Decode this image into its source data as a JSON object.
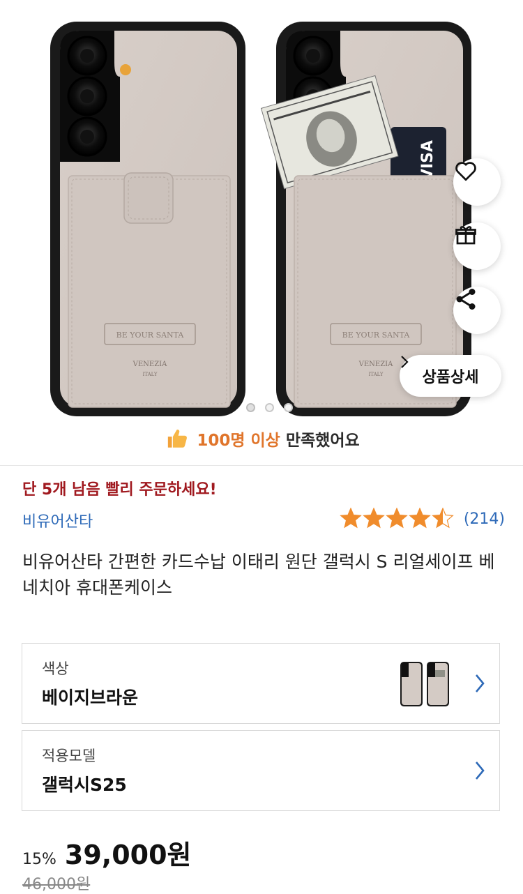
{
  "product_gallery": {
    "detail_button_label": "상품상세",
    "dots_total": 3,
    "dots_active_index": 0,
    "print_text": {
      "be_your_santa": "BE YOUR SANTA",
      "venezia": "VENEZIA",
      "italy": "ITALY",
      "visa": "VISA"
    }
  },
  "satisfaction": {
    "highlight": "100명 이상",
    "rest": "만족했어요"
  },
  "urgency_text": "단 5개 남음 빨리 주문하세요!",
  "brand_name": "비유어산타",
  "rating": {
    "stars": 4.5,
    "count_label": "(214)"
  },
  "product_title": "비유어산타 간편한 카드수납 이태리 원단 갤럭시 S 리얼세이프 베네치아 휴대폰케이스",
  "options": [
    {
      "label": "색상",
      "value": "베이지브라운",
      "has_thumbnail": true
    },
    {
      "label": "적용모델",
      "value": "갤럭시S25",
      "has_thumbnail": false
    }
  ],
  "price": {
    "discount": "15%",
    "sale": "39,000원",
    "original": "46,000원"
  },
  "colors": {
    "accent_blue": "#2e6ab8",
    "urgency_red": "#a0191f",
    "star_orange": "#f08c2c",
    "satisfied_orange": "#e0752b",
    "case_beige": "#d4cbc5"
  },
  "icons": [
    "heart-icon",
    "gift-icon",
    "share-icon",
    "chevron-right-icon",
    "thumbs-up-icon",
    "star-icon"
  ]
}
